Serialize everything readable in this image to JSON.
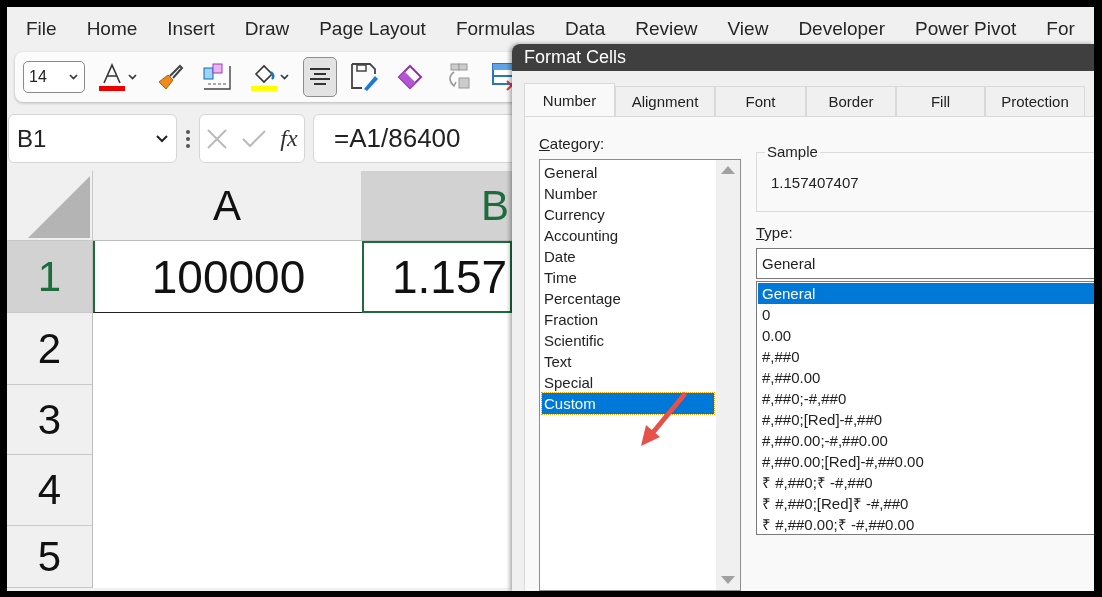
{
  "menu_bar": {
    "items": [
      "File",
      "Home",
      "Insert",
      "Draw",
      "Page Layout",
      "Formulas",
      "Data",
      "Review",
      "View",
      "Developer",
      "Power Pivot",
      "For"
    ]
  },
  "toolbar": {
    "font_size": "14",
    "tools": [
      {
        "kind": "font-color",
        "pressed": false
      },
      {
        "kind": "format-painter",
        "pressed": false
      },
      {
        "kind": "boxes",
        "pressed": false
      },
      {
        "kind": "fill-color",
        "pressed": false
      },
      {
        "kind": "align-center",
        "pressed": true
      },
      {
        "kind": "save-edit",
        "pressed": false
      },
      {
        "kind": "eraser",
        "pressed": false
      },
      {
        "kind": "move-cells",
        "pressed": false
      },
      {
        "kind": "delete-table",
        "pressed": false
      }
    ]
  },
  "formula_bar": {
    "name_box": "B1",
    "fx_label": "fx",
    "formula": "=A1/86400"
  },
  "sheet": {
    "columns": [
      {
        "label": "A",
        "selected": false
      },
      {
        "label": "B",
        "selected": true
      }
    ],
    "rows": [
      {
        "label": "1",
        "selected": true,
        "cells": [
          {
            "value": "100000",
            "selected": false
          },
          {
            "value": "1.157",
            "selected": true
          }
        ]
      },
      {
        "label": "2",
        "selected": false
      },
      {
        "label": "3",
        "selected": false
      },
      {
        "label": "4",
        "selected": false
      },
      {
        "label": "5",
        "selected": false
      }
    ]
  },
  "dialog": {
    "title": "Format Cells",
    "tabs": [
      {
        "label": "Number",
        "selected": true
      },
      {
        "label": "Alignment",
        "selected": false
      },
      {
        "label": "Font",
        "selected": false
      },
      {
        "label": "Border",
        "selected": false
      },
      {
        "label": "Fill",
        "selected": false
      },
      {
        "label": "Protection",
        "selected": false
      }
    ],
    "category": {
      "label": "Category:",
      "items": [
        {
          "label": "General",
          "selected": false
        },
        {
          "label": "Number",
          "selected": false
        },
        {
          "label": "Currency",
          "selected": false
        },
        {
          "label": "Accounting",
          "selected": false
        },
        {
          "label": "Date",
          "selected": false
        },
        {
          "label": "Time",
          "selected": false
        },
        {
          "label": "Percentage",
          "selected": false
        },
        {
          "label": "Fraction",
          "selected": false
        },
        {
          "label": "Scientific",
          "selected": false
        },
        {
          "label": "Text",
          "selected": false
        },
        {
          "label": "Special",
          "selected": false
        },
        {
          "label": "Custom",
          "selected": true
        }
      ]
    },
    "sample": {
      "label": "Sample",
      "value": "1.157407407"
    },
    "type": {
      "label": "Type:",
      "value": "General",
      "items": [
        {
          "label": "General",
          "selected": true
        },
        {
          "label": "0",
          "selected": false
        },
        {
          "label": "0.00",
          "selected": false
        },
        {
          "label": "#,##0",
          "selected": false
        },
        {
          "label": "#,##0.00",
          "selected": false
        },
        {
          "label": "#,##0;-#,##0",
          "selected": false
        },
        {
          "label": "#,##0;[Red]-#,##0",
          "selected": false
        },
        {
          "label": "#,##0.00;-#,##0.00",
          "selected": false
        },
        {
          "label": "#,##0.00;[Red]-#,##0.00",
          "selected": false
        },
        {
          "label": "₹ #,##0;₹ -#,##0",
          "selected": false
        },
        {
          "label": "₹ #,##0;[Red]₹ -#,##0",
          "selected": false
        },
        {
          "label": "₹ #,##0.00;₹ -#,##0.00",
          "selected": false
        }
      ]
    }
  }
}
